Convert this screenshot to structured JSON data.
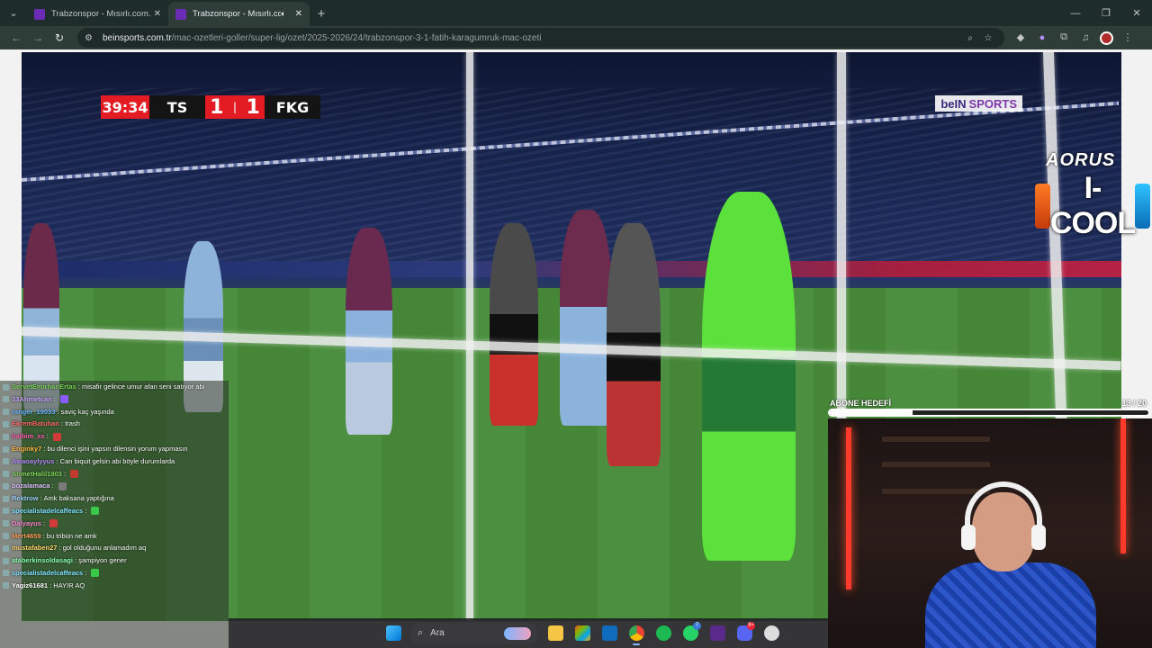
{
  "tabs": [
    {
      "title": "Trabzonspor - Mısırlı.com.tr Fatih",
      "active": false
    },
    {
      "title": "Trabzonspor - Mısırlı.com.tr",
      "active": true
    }
  ],
  "address": {
    "host": "beinsports.com.tr",
    "path": "/mac-ozetleri-goller/super-lig/ozet/2025-2026/24/trabzonspor-3-1-fatih-karagumruk-mac-ozeti"
  },
  "scoreboard": {
    "time": "39:34",
    "home_team": "TS",
    "home_score": "1",
    "separator": "|",
    "away_score": "1",
    "away_team": "FKG"
  },
  "broadcaster": {
    "name": "beIN",
    "suffix": "SPORTS"
  },
  "overlays": {
    "sponsor": "AORUS",
    "drink": "I-COOL"
  },
  "chat": [
    {
      "user": "ServetEmirhanErtas",
      "message": "misafir gelince umur afan seni satıyor abi",
      "color": "#7fd45a",
      "emote": null
    },
    {
      "user": "33Ahmetcan",
      "message": "",
      "color": "#c9a8ff",
      "emote": "#8a5cff"
    },
    {
      "user": "ranger_19033",
      "message": "saviç kaç yaşında",
      "color": "#6db7ff",
      "emote": null
    },
    {
      "user": "EkremBatuhan",
      "message": "trash",
      "color": "#ff6a6a",
      "emote": null
    },
    {
      "user": "balbim_xx",
      "message": "",
      "color": "#ff5fb0",
      "emote": "#d03a3a"
    },
    {
      "user": "Enginky7",
      "message": "bu dilenci işini yapsın dilensin yorum yapmasın",
      "color": "#ffb84a",
      "emote": null
    },
    {
      "user": "Awaoaylyyus",
      "message": "Can biquit gelsin abi böyle durumlarda",
      "color": "#b68cff",
      "emote": null
    },
    {
      "user": "AhmetHalil1903",
      "message": "",
      "color": "#7fd45a",
      "emote": "#c0392b"
    },
    {
      "user": "bozalamaca",
      "message": "",
      "color": "#e0c0ff",
      "emote": "#7a7a7a"
    },
    {
      "user": "Rektrow",
      "message": "Amk baksana yaptığına",
      "color": "#9ad0ff",
      "emote": null
    },
    {
      "user": "specialistadelcaffeacs",
      "message": "",
      "color": "#7fe0ff",
      "emote": "#3ac84a"
    },
    {
      "user": "Dalyayus",
      "message": "",
      "color": "#ff8ad0",
      "emote": "#d03a3a"
    },
    {
      "user": "Mert4659",
      "message": "bu tribün ne amk",
      "color": "#ff9d5a",
      "emote": null
    },
    {
      "user": "mustafaben27",
      "message": "gol olduğunu anlamadım aq",
      "color": "#ffd26a",
      "emote": null
    },
    {
      "user": "ataberkinsoldasagi",
      "message": "şampiyon gener",
      "color": "#8affb0",
      "emote": null
    },
    {
      "user": "specialistadelcaffeacs",
      "message": "",
      "color": "#7fe0ff",
      "emote": "#3ac84a"
    },
    {
      "user": "Yagiz61681",
      "message": "HAYIR AQ",
      "color": "#ffffff",
      "emote": null
    }
  ],
  "subgoal": {
    "label": "ABONE HEDEFİ",
    "count": "13 / 20",
    "progress": 0.26
  },
  "taskbar": {
    "search_placeholder": "Ara",
    "whatsapp_badge": "7",
    "discord_badge": "9+"
  },
  "colors": {
    "scoreboard_red": "#e31b23",
    "tab_bg": "#1f2d2a",
    "toolbar_bg": "#2f3d39"
  },
  "icons": {
    "start": "windows-icon",
    "search": "search-icon",
    "files": "folder-icon",
    "store": "store-icon",
    "outlook": "mail-icon",
    "chrome": "chrome-icon",
    "spotify": "spotify-icon",
    "whatsapp": "whatsapp-icon",
    "next": "next-icon",
    "discord": "discord-icon",
    "settings": "settings-icon"
  }
}
